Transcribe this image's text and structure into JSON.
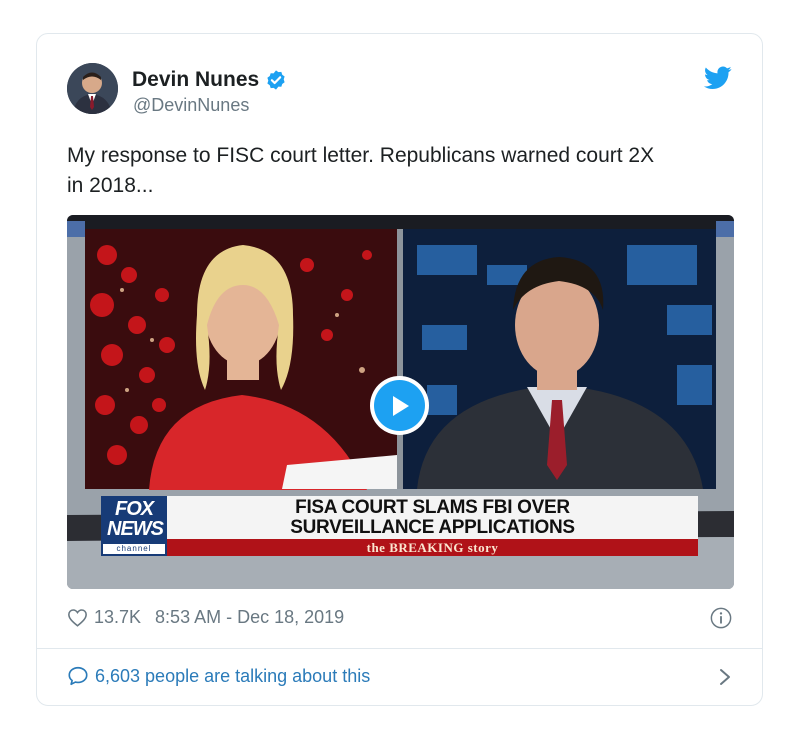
{
  "author": {
    "name": "Devin Nunes",
    "handle": "@DevinNunes",
    "verified": true
  },
  "tweet": {
    "text_line1": "My response to FISC court letter. Republicans warned court 2X",
    "text_line2": "in 2018..."
  },
  "video": {
    "chyron_line1": "FISA COURT SLAMS FBI OVER",
    "chyron_line2": "SURVEILLANCE APPLICATIONS",
    "chyron_sub": "the BREAKING story",
    "logo_fox": "FOX",
    "logo_news": "NEWS",
    "logo_channel": "channel",
    "play_icon": "play-icon"
  },
  "meta": {
    "likes": "13.7K",
    "timestamp": "8:53 AM - Dec 18, 2019"
  },
  "footer": {
    "talking_text": "6,603 people are talking about this"
  },
  "colors": {
    "twitter_blue": "#1da1f2",
    "link_blue": "#2b7bb9",
    "muted_gray": "#697882",
    "fox_red": "#b01218",
    "fox_blue": "#173b77"
  }
}
